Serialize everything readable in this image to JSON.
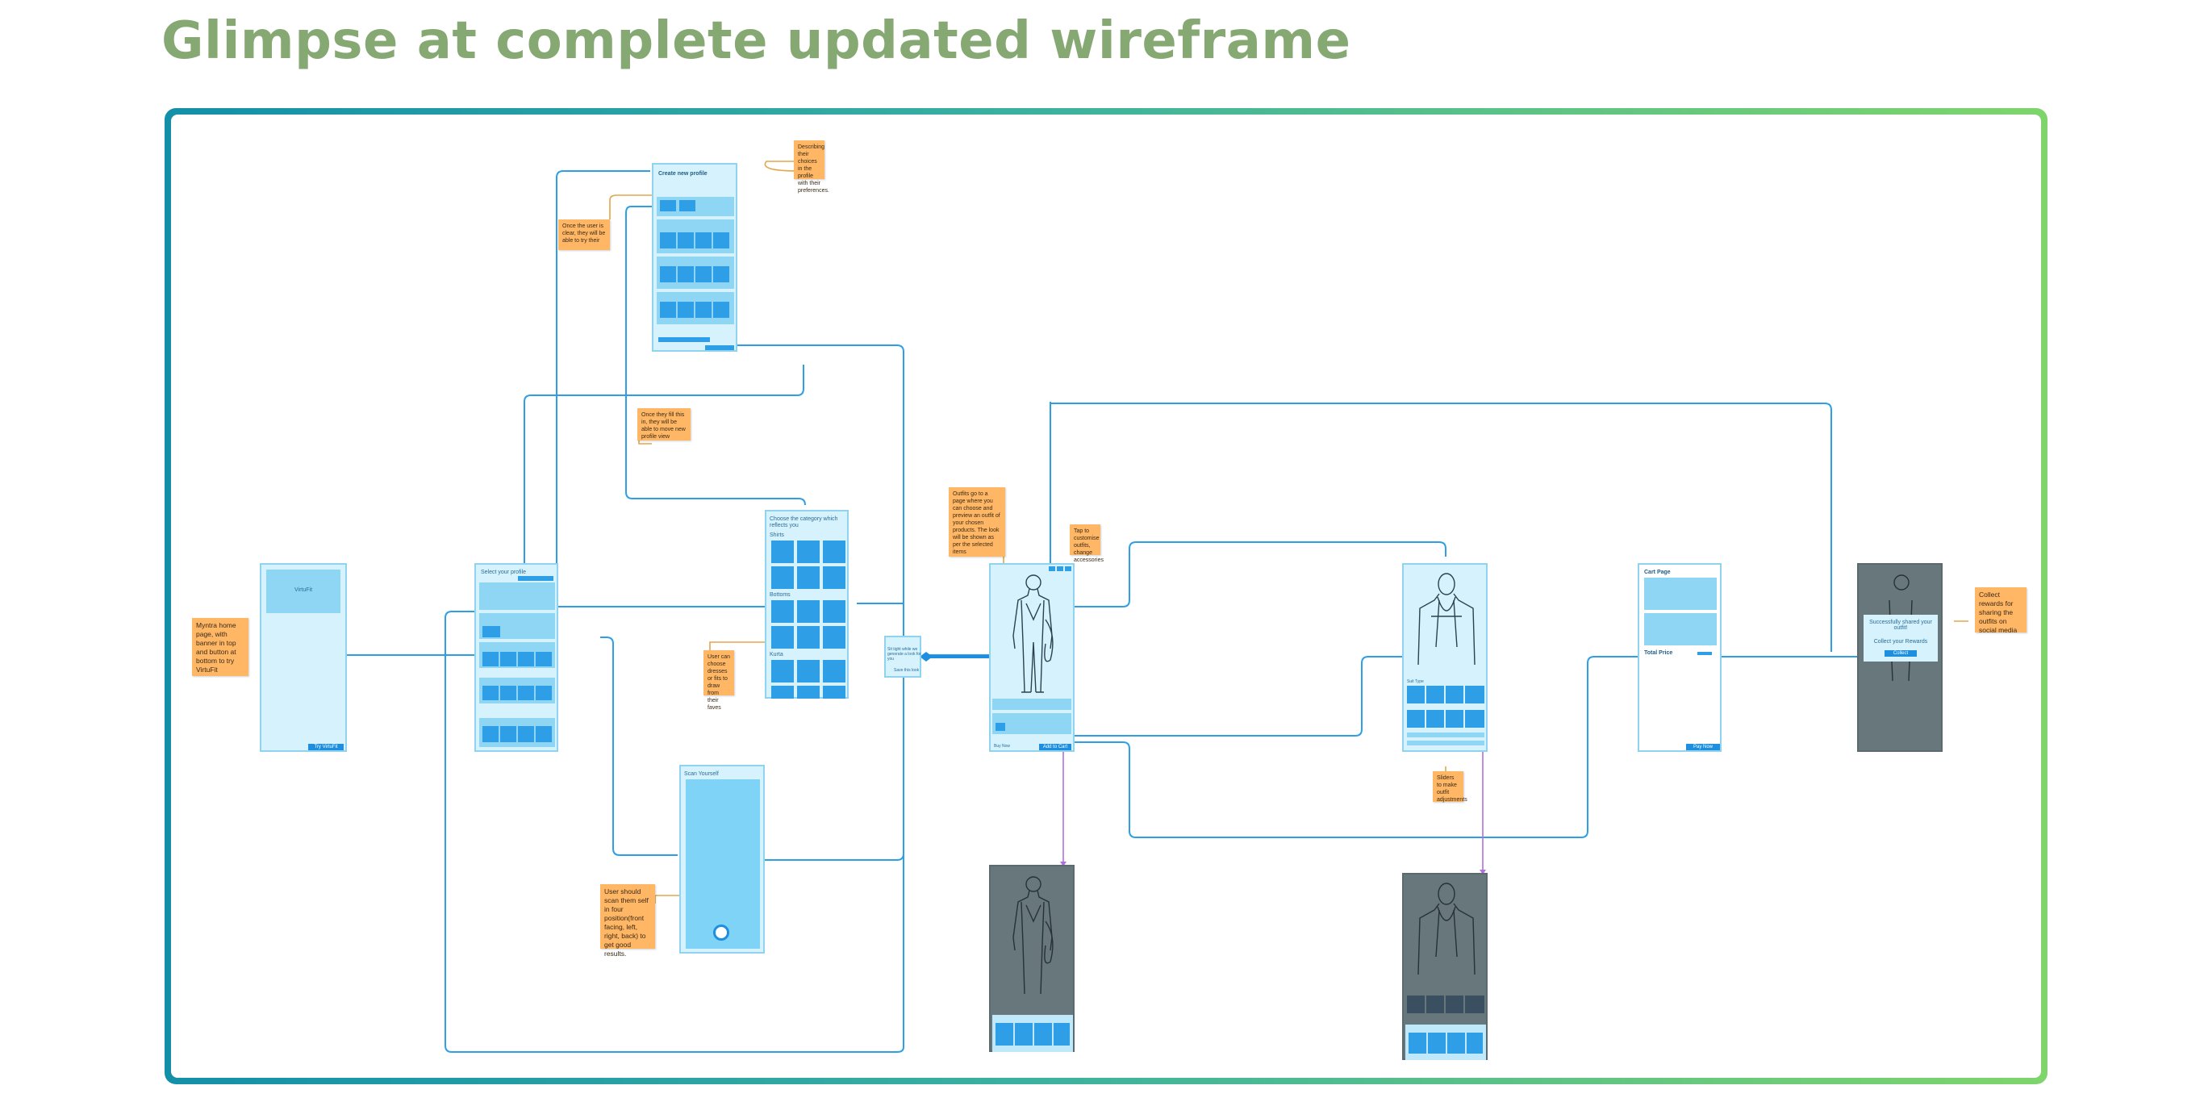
{
  "title": "Glimpse at complete updated wireframe",
  "colors": {
    "title": "#86a873",
    "wire": "#2e9fe6",
    "purple_wire": "#b070e0",
    "note": "#ffb766",
    "screen": "#d6f2fc"
  },
  "notes": {
    "home": "Myntra home page, with banner in top and button at bottom to try VirtuFit",
    "profile_view": "Once the user is clear, they will be able to try their",
    "profile_prefs": "Describing their choices in the profile with their preferences.",
    "profile_back": "Once they fill this in, they will be able to move new profile view",
    "categories": "User can choose dresses or fits to draw from their faves",
    "scan": "User should scan them self in four position(front facing, left, right, back) to get good results.",
    "outfit": "Outfits go to a page where you can choose and preview an outfit of your chosen products. The look will be shown as per the selected items",
    "tryon": "Tap to customise outfits, change accessories",
    "customize": "Sliders to make outfit adjustments",
    "rewards": "Collect rewards for sharing the outfits on social media"
  },
  "screens": {
    "home": {
      "banner": "VirtuFit",
      "button": "Try VirtuFit"
    },
    "profile": {
      "title": "Create new profile"
    },
    "categories": {
      "title": "Choose the category which reflects you",
      "sections": [
        "Shirts",
        "Bottoms",
        "Kurta"
      ]
    },
    "scan": {
      "title": "Scan Yourself"
    },
    "loading": {
      "label": "Sit tight while we generate a look for you",
      "link": "Save this look"
    },
    "tryon": {
      "price": "Buy Now",
      "label": "Add to Cart"
    },
    "cart": {
      "title": "Cart Page",
      "total": "Total Price",
      "button": "Pay Now"
    },
    "reward": {
      "line1": "Successfully shared your outfit!",
      "line2": "Collect your Rewards",
      "button": "Collect"
    }
  }
}
